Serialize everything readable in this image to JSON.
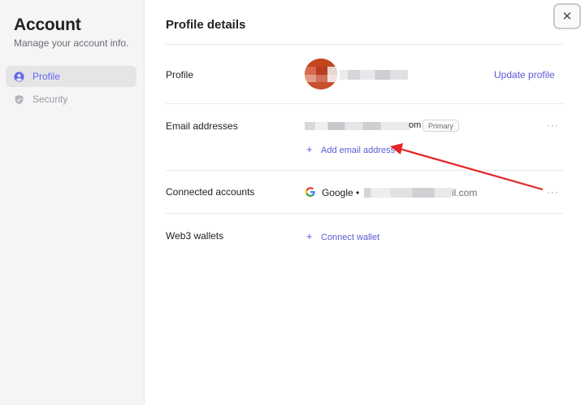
{
  "sidebar": {
    "title": "Account",
    "subtitle": "Manage your account info.",
    "items": [
      {
        "label": "Profile",
        "icon": "user-circle-icon",
        "active": true
      },
      {
        "label": "Security",
        "icon": "shield-icon",
        "active": false
      }
    ]
  },
  "main": {
    "title": "Profile details",
    "profile": {
      "label": "Profile",
      "update_label": "Update profile"
    },
    "email": {
      "label": "Email addresses",
      "address": "om",
      "badge": "Primary",
      "more": "···",
      "add_label": "Add email address"
    },
    "connected": {
      "label": "Connected accounts",
      "provider": "Google",
      "bullet": "•",
      "email": "il.com",
      "more": "···"
    },
    "web3": {
      "label": "Web3 wallets",
      "connect_label": "Connect wallet"
    }
  },
  "close_label": "✕",
  "colors": {
    "accent": "#6366f1",
    "annotation_arrow": "#e32626",
    "sidebar_bg": "#f5f5f6"
  }
}
